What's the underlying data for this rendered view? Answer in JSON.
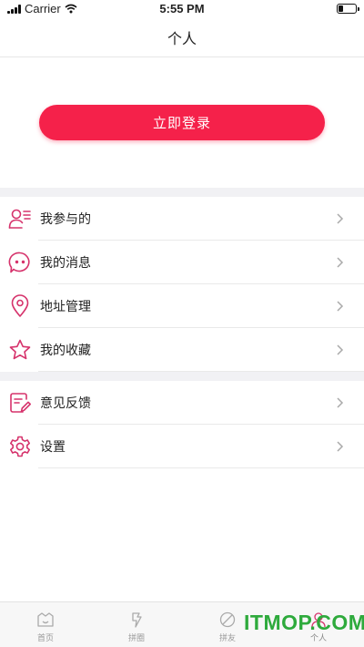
{
  "status_bar": {
    "carrier": "Carrier",
    "time": "5:55 PM"
  },
  "nav": {
    "title": "个人"
  },
  "login": {
    "button_label": "立即登录"
  },
  "menu_group_1": [
    {
      "label": "我参与的",
      "icon": "user-list-icon"
    },
    {
      "label": "我的消息",
      "icon": "chat-bubble-icon"
    },
    {
      "label": "地址管理",
      "icon": "location-pin-icon"
    },
    {
      "label": "我的收藏",
      "icon": "star-icon"
    }
  ],
  "menu_group_2": [
    {
      "label": "意见反馈",
      "icon": "feedback-icon"
    },
    {
      "label": "设置",
      "icon": "gear-icon"
    }
  ],
  "tabs": [
    {
      "label": "首页",
      "icon": "home-icon",
      "active": false
    },
    {
      "label": "拼圈",
      "icon": "circle-icon",
      "active": false
    },
    {
      "label": "拼友",
      "icon": "friends-icon",
      "active": false
    },
    {
      "label": "个人",
      "icon": "person-icon",
      "active": true
    }
  ],
  "watermark": {
    "text": "ITMOP.COM"
  },
  "colors": {
    "accent": "#f5214a",
    "icon": "#d6336c",
    "separator": "#f1f1f4",
    "watermark": "#2eaa3c"
  }
}
